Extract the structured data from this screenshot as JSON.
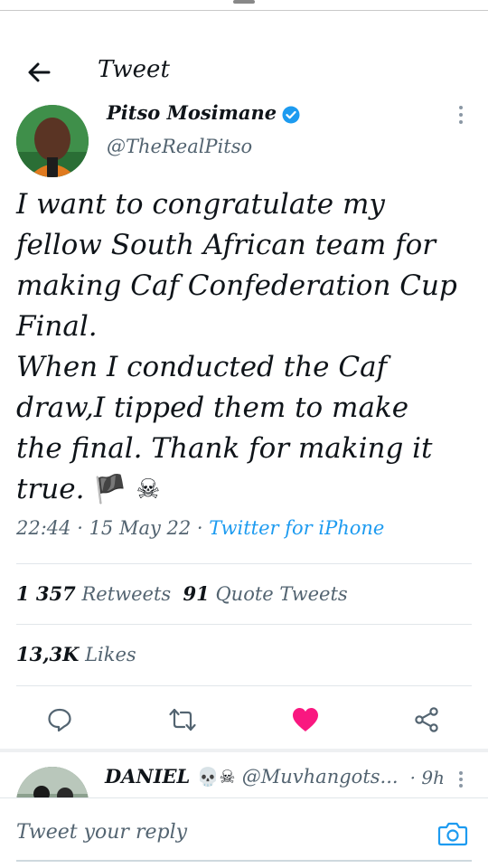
{
  "header": {
    "title": "Tweet"
  },
  "author": {
    "name": "Pitso Mosimane",
    "handle": "@TheRealPitso"
  },
  "tweet": {
    "lines": [
      "I want to congratulate my",
      "fellow South African team for",
      "making Caf Confederation Cup",
      "Final.",
      "When I conducted the Caf",
      "draw,I tipped them to make",
      "the final. Thank for making it"
    ],
    "last_line": "true.",
    "emoji_flag": "🏴",
    "emoji_skull": "☠",
    "time": "22:44",
    "date": "15 May 22",
    "source": "Twitter for iPhone"
  },
  "stats": {
    "retweets_count": "1 357",
    "retweets_label": "Retweets",
    "quotes_count": "91",
    "quotes_label": "Quote Tweets",
    "likes_count": "13,3K",
    "likes_label": "Likes"
  },
  "actions": {
    "reply_icon": "comment-icon",
    "retweet_icon": "retweet-icon",
    "like_icon": "heart-filled-icon",
    "share_icon": "share-icon",
    "like_color": "#f91880"
  },
  "reply": {
    "name": "DANIEL",
    "emojis": "💀☠",
    "handle": "@Muvhangots...",
    "time": "· 9h"
  },
  "composer": {
    "placeholder": "Tweet your reply"
  },
  "colors": {
    "accent": "#1d9bf0",
    "text": "#0f1419",
    "muted": "#536471"
  }
}
